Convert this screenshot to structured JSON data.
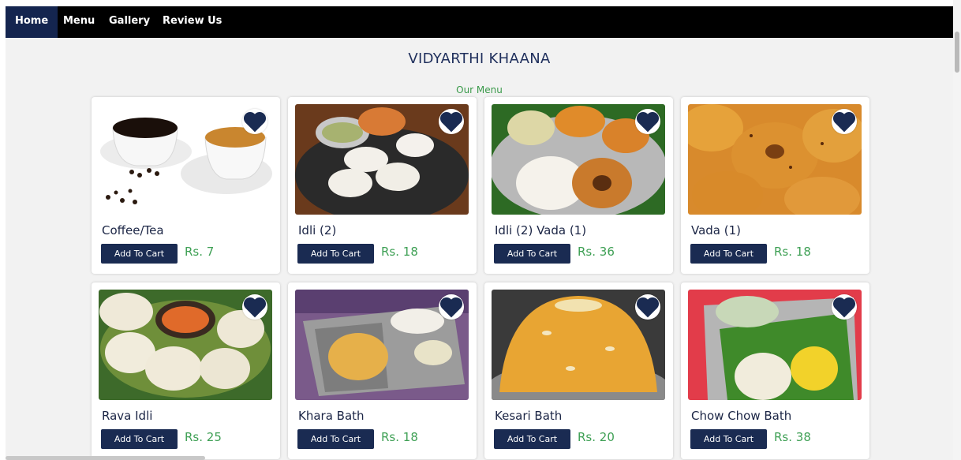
{
  "nav": {
    "home": "Home",
    "menu": "Menu",
    "gallery": "Gallery",
    "review": "Review Us"
  },
  "header": {
    "title": "VIDYARTHI KHAANA",
    "subtitle": "Our Menu"
  },
  "cart_label": "Add To Cart",
  "items": [
    {
      "name": "Coffee/Tea",
      "price": "Rs. 7"
    },
    {
      "name": "Idli (2)",
      "price": "Rs. 18"
    },
    {
      "name": "Idli (2) Vada (1)",
      "price": "Rs. 36"
    },
    {
      "name": "Vada (1)",
      "price": "Rs. 18"
    },
    {
      "name": "Rava Idli",
      "price": "Rs. 25"
    },
    {
      "name": "Khara Bath",
      "price": "Rs. 18"
    },
    {
      "name": "Kesari Bath",
      "price": "Rs. 20"
    },
    {
      "name": "Chow Chow Bath",
      "price": "Rs. 38"
    }
  ],
  "icons": {
    "favorite": "heart-icon"
  },
  "colors": {
    "navbar": "#000000",
    "active_nav": "#14254f",
    "button": "#1a2b52",
    "price": "#3fa055",
    "subtitle": "#3a9a4a"
  }
}
